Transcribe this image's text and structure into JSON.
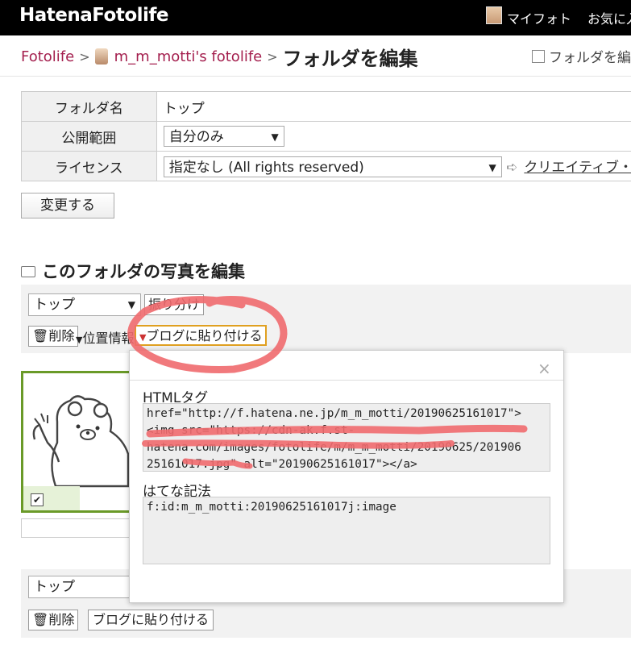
{
  "header": {
    "logo": "HatenaFotolife",
    "myfoto": "マイフォト",
    "notice": "お気に入"
  },
  "breadcrumb": {
    "root": "Fotolife",
    "user": "m_m_motti's fotolife",
    "current": "フォルダを編集"
  },
  "edit_link": "フォルダを編集",
  "settings": {
    "folder_name_label": "フォルダ名",
    "folder_name_value": "トップ",
    "visibility_label": "公開範囲",
    "visibility_value": "自分のみ",
    "license_label": "ライセンス",
    "license_value": "指定なし (All rights reserved)",
    "cc_link": "クリエイティブ・",
    "change_button": "変更する"
  },
  "photos_section": {
    "title": "このフォルダの写真を編集",
    "folder_select": "トップ",
    "sort_button": "振り分け",
    "delete_button": "削除",
    "location_button": "位置情報",
    "blog_button": "ブログに貼り付ける"
  },
  "popup": {
    "close": "×",
    "html_label": "HTMLタグ",
    "html_code": "href=\"http://f.hatena.ne.jp/m_m_motti/20190625161017\">\n<img src=\"https://cdn-ak.f.st-\nhatena.com/images/fotolife/m/m_m_motti/20190625/201906\n25161017.jpg\" alt=\"20190625161017\"></a>",
    "hatena_label": "はてな記法",
    "hatena_code": "f:id:m_m_motti:20190625161017j:image"
  },
  "bottom_toolbar": {
    "folder_select": "トップ",
    "delete_button": "削除",
    "blog_button": "ブログに貼り付ける"
  },
  "colors": {
    "accent": "#a41f4e",
    "annotation": "#f06a6e",
    "photo_border": "#6a9a28"
  }
}
